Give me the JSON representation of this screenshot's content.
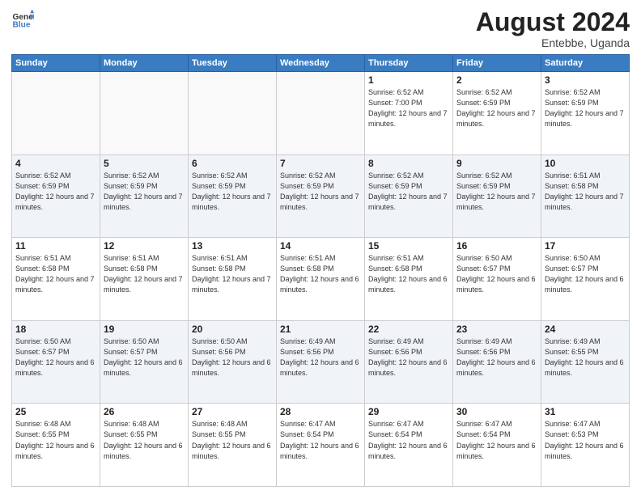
{
  "header": {
    "logo_general": "General",
    "logo_blue": "Blue",
    "month_year": "August 2024",
    "location": "Entebbe, Uganda"
  },
  "days_of_week": [
    "Sunday",
    "Monday",
    "Tuesday",
    "Wednesday",
    "Thursday",
    "Friday",
    "Saturday"
  ],
  "weeks": [
    [
      {
        "day": "",
        "sunrise": "",
        "sunset": "",
        "daylight": ""
      },
      {
        "day": "",
        "sunrise": "",
        "sunset": "",
        "daylight": ""
      },
      {
        "day": "",
        "sunrise": "",
        "sunset": "",
        "daylight": ""
      },
      {
        "day": "",
        "sunrise": "",
        "sunset": "",
        "daylight": ""
      },
      {
        "day": "1",
        "sunrise": "Sunrise: 6:52 AM",
        "sunset": "Sunset: 7:00 PM",
        "daylight": "Daylight: 12 hours and 7 minutes."
      },
      {
        "day": "2",
        "sunrise": "Sunrise: 6:52 AM",
        "sunset": "Sunset: 6:59 PM",
        "daylight": "Daylight: 12 hours and 7 minutes."
      },
      {
        "day": "3",
        "sunrise": "Sunrise: 6:52 AM",
        "sunset": "Sunset: 6:59 PM",
        "daylight": "Daylight: 12 hours and 7 minutes."
      }
    ],
    [
      {
        "day": "4",
        "sunrise": "Sunrise: 6:52 AM",
        "sunset": "Sunset: 6:59 PM",
        "daylight": "Daylight: 12 hours and 7 minutes."
      },
      {
        "day": "5",
        "sunrise": "Sunrise: 6:52 AM",
        "sunset": "Sunset: 6:59 PM",
        "daylight": "Daylight: 12 hours and 7 minutes."
      },
      {
        "day": "6",
        "sunrise": "Sunrise: 6:52 AM",
        "sunset": "Sunset: 6:59 PM",
        "daylight": "Daylight: 12 hours and 7 minutes."
      },
      {
        "day": "7",
        "sunrise": "Sunrise: 6:52 AM",
        "sunset": "Sunset: 6:59 PM",
        "daylight": "Daylight: 12 hours and 7 minutes."
      },
      {
        "day": "8",
        "sunrise": "Sunrise: 6:52 AM",
        "sunset": "Sunset: 6:59 PM",
        "daylight": "Daylight: 12 hours and 7 minutes."
      },
      {
        "day": "9",
        "sunrise": "Sunrise: 6:52 AM",
        "sunset": "Sunset: 6:59 PM",
        "daylight": "Daylight: 12 hours and 7 minutes."
      },
      {
        "day": "10",
        "sunrise": "Sunrise: 6:51 AM",
        "sunset": "Sunset: 6:58 PM",
        "daylight": "Daylight: 12 hours and 7 minutes."
      }
    ],
    [
      {
        "day": "11",
        "sunrise": "Sunrise: 6:51 AM",
        "sunset": "Sunset: 6:58 PM",
        "daylight": "Daylight: 12 hours and 7 minutes."
      },
      {
        "day": "12",
        "sunrise": "Sunrise: 6:51 AM",
        "sunset": "Sunset: 6:58 PM",
        "daylight": "Daylight: 12 hours and 7 minutes."
      },
      {
        "day": "13",
        "sunrise": "Sunrise: 6:51 AM",
        "sunset": "Sunset: 6:58 PM",
        "daylight": "Daylight: 12 hours and 7 minutes."
      },
      {
        "day": "14",
        "sunrise": "Sunrise: 6:51 AM",
        "sunset": "Sunset: 6:58 PM",
        "daylight": "Daylight: 12 hours and 6 minutes."
      },
      {
        "day": "15",
        "sunrise": "Sunrise: 6:51 AM",
        "sunset": "Sunset: 6:58 PM",
        "daylight": "Daylight: 12 hours and 6 minutes."
      },
      {
        "day": "16",
        "sunrise": "Sunrise: 6:50 AM",
        "sunset": "Sunset: 6:57 PM",
        "daylight": "Daylight: 12 hours and 6 minutes."
      },
      {
        "day": "17",
        "sunrise": "Sunrise: 6:50 AM",
        "sunset": "Sunset: 6:57 PM",
        "daylight": "Daylight: 12 hours and 6 minutes."
      }
    ],
    [
      {
        "day": "18",
        "sunrise": "Sunrise: 6:50 AM",
        "sunset": "Sunset: 6:57 PM",
        "daylight": "Daylight: 12 hours and 6 minutes."
      },
      {
        "day": "19",
        "sunrise": "Sunrise: 6:50 AM",
        "sunset": "Sunset: 6:57 PM",
        "daylight": "Daylight: 12 hours and 6 minutes."
      },
      {
        "day": "20",
        "sunrise": "Sunrise: 6:50 AM",
        "sunset": "Sunset: 6:56 PM",
        "daylight": "Daylight: 12 hours and 6 minutes."
      },
      {
        "day": "21",
        "sunrise": "Sunrise: 6:49 AM",
        "sunset": "Sunset: 6:56 PM",
        "daylight": "Daylight: 12 hours and 6 minutes."
      },
      {
        "day": "22",
        "sunrise": "Sunrise: 6:49 AM",
        "sunset": "Sunset: 6:56 PM",
        "daylight": "Daylight: 12 hours and 6 minutes."
      },
      {
        "day": "23",
        "sunrise": "Sunrise: 6:49 AM",
        "sunset": "Sunset: 6:56 PM",
        "daylight": "Daylight: 12 hours and 6 minutes."
      },
      {
        "day": "24",
        "sunrise": "Sunrise: 6:49 AM",
        "sunset": "Sunset: 6:55 PM",
        "daylight": "Daylight: 12 hours and 6 minutes."
      }
    ],
    [
      {
        "day": "25",
        "sunrise": "Sunrise: 6:48 AM",
        "sunset": "Sunset: 6:55 PM",
        "daylight": "Daylight: 12 hours and 6 minutes."
      },
      {
        "day": "26",
        "sunrise": "Sunrise: 6:48 AM",
        "sunset": "Sunset: 6:55 PM",
        "daylight": "Daylight: 12 hours and 6 minutes."
      },
      {
        "day": "27",
        "sunrise": "Sunrise: 6:48 AM",
        "sunset": "Sunset: 6:55 PM",
        "daylight": "Daylight: 12 hours and 6 minutes."
      },
      {
        "day": "28",
        "sunrise": "Sunrise: 6:47 AM",
        "sunset": "Sunset: 6:54 PM",
        "daylight": "Daylight: 12 hours and 6 minutes."
      },
      {
        "day": "29",
        "sunrise": "Sunrise: 6:47 AM",
        "sunset": "Sunset: 6:54 PM",
        "daylight": "Daylight: 12 hours and 6 minutes."
      },
      {
        "day": "30",
        "sunrise": "Sunrise: 6:47 AM",
        "sunset": "Sunset: 6:54 PM",
        "daylight": "Daylight: 12 hours and 6 minutes."
      },
      {
        "day": "31",
        "sunrise": "Sunrise: 6:47 AM",
        "sunset": "Sunset: 6:53 PM",
        "daylight": "Daylight: 12 hours and 6 minutes."
      }
    ]
  ]
}
